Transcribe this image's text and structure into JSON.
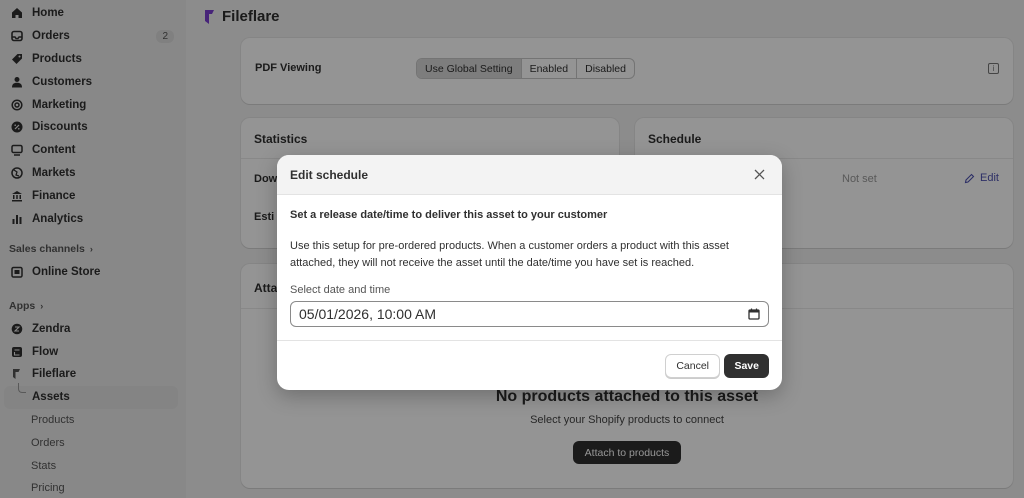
{
  "sidebar": {
    "items": [
      {
        "label": "Home",
        "icon": "home-icon"
      },
      {
        "label": "Orders",
        "icon": "inbox-icon",
        "badge": "2"
      },
      {
        "label": "Products",
        "icon": "tag-icon"
      },
      {
        "label": "Customers",
        "icon": "person-icon"
      },
      {
        "label": "Marketing",
        "icon": "target-icon"
      },
      {
        "label": "Discounts",
        "icon": "discount-icon"
      },
      {
        "label": "Content",
        "icon": "content-icon"
      },
      {
        "label": "Markets",
        "icon": "globe-icon"
      },
      {
        "label": "Finance",
        "icon": "bank-icon"
      },
      {
        "label": "Analytics",
        "icon": "bar-chart-icon"
      }
    ],
    "sales_channels_label": "Sales channels",
    "online_store": "Online Store",
    "apps_label": "Apps",
    "apps": [
      {
        "label": "Zendra"
      },
      {
        "label": "Flow"
      },
      {
        "label": "Fileflare"
      }
    ],
    "assets": "Assets",
    "sub_items": [
      "Products",
      "Orders",
      "Stats",
      "Pricing"
    ]
  },
  "header": {
    "title": "Fileflare"
  },
  "pdf_card": {
    "label": "PDF Viewing",
    "options": [
      "Use Global Setting",
      "Enabled",
      "Disabled"
    ],
    "selected": "Use Global Setting"
  },
  "statistics_card": {
    "title": "Statistics",
    "row1": "Dow",
    "row2": "Esti"
  },
  "schedule_card": {
    "title": "Schedule",
    "value": "Not set",
    "edit": "Edit"
  },
  "attached_card": {
    "title": "Atta",
    "empty_title": "No products attached to this asset",
    "empty_sub": "Select your Shopify products to connect",
    "button": "Attach to products"
  },
  "modal": {
    "title": "Edit schedule",
    "heading": "Set a release date/time to deliver this asset to your customer",
    "description": "Use this setup for pre-ordered products. When a customer orders a product with this asset attached, they will not receive the asset until the date/time you have set is reached.",
    "field_label": "Select date and time",
    "field_value": "05/01/2026, 10:00 AM",
    "cancel": "Cancel",
    "save": "Save"
  },
  "colors": {
    "primary_button": "#303030",
    "link": "#4f52b0",
    "brand": "#7a3fd1"
  }
}
